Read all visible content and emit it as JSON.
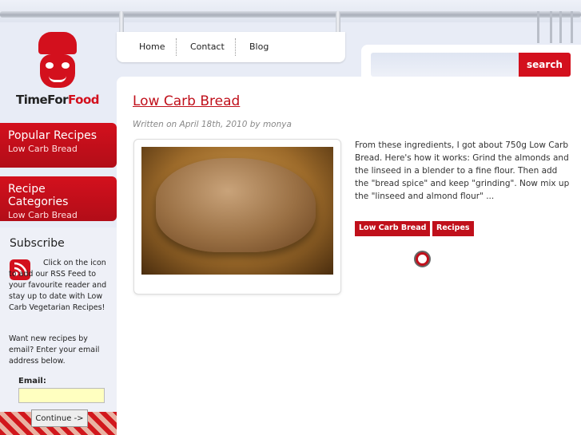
{
  "brand": {
    "part1": "TimeFor",
    "part2": "Food"
  },
  "nav": {
    "items": [
      "Home",
      "Contact",
      "Blog"
    ]
  },
  "search": {
    "button_label": "search",
    "placeholder": ""
  },
  "sidebar": {
    "popular": {
      "title": "Popular Recipes",
      "link": "Low Carb Bread"
    },
    "categories": {
      "title": "Recipe Categories",
      "link": "Low Carb Bread"
    },
    "subscribe": {
      "title": "Subscribe",
      "rss_text": "Click on the icon to add our RSS Feed to your favourite reader and stay up to date with Low Carb Vegetarian Recipes!",
      "email_text": "Want new recipes by email? Enter your email address below.",
      "email_label": "Email:",
      "continue_label": "Continue ->"
    }
  },
  "post": {
    "title": "Low Carb Bread",
    "meta": "Written on April 18th, 2010 by monya",
    "excerpt": "From these ingredients, I got about 750g Low Carb Bread. Here's how it works: Grind the almonds and the linseed in a blender to a fine flour. Then add the \"bread spice\" and keep \"grinding\". Now mix up the \"linseed and almond flour\" ...",
    "tags": [
      "Low Carb Bread",
      "Recipes"
    ]
  },
  "colors": {
    "accent": "#d3101d",
    "link": "#c0101b"
  },
  "icons": [
    "chef-logo-icon",
    "rss-icon",
    "timer-icon",
    "rail-hook-icon"
  ]
}
